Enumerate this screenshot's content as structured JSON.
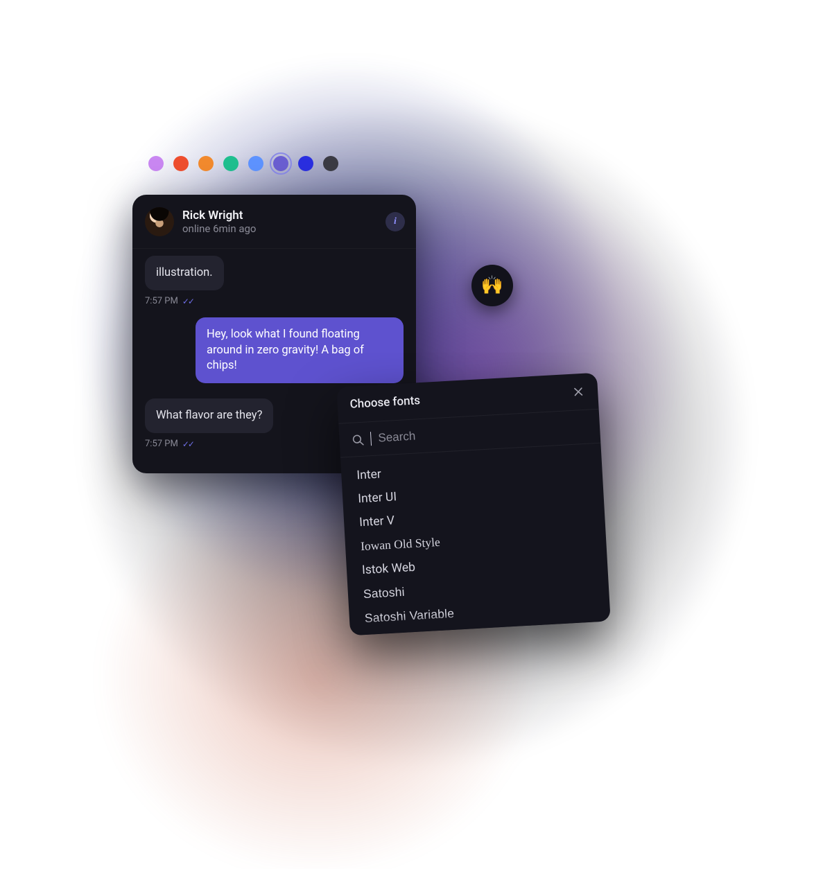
{
  "colors": {
    "swatches": [
      "#c987f2",
      "#ee4e2e",
      "#f28a2e",
      "#1fbf8f",
      "#5e93ff",
      "#6a5ed1",
      "#2a2fe0",
      "#3b3b44"
    ],
    "selected_index": 5
  },
  "chat": {
    "name": "Rick Wright",
    "status": "online 6min ago",
    "messages": [
      {
        "text": "illustration.",
        "mine": false,
        "time": "7:57 PM",
        "read": true
      },
      {
        "text": "Hey, look what I found floating around in zero gravity! A bag of chips!",
        "mine": true,
        "time": "",
        "read": false
      },
      {
        "text": "What flavor are they?",
        "mine": false,
        "time": "7:57 PM",
        "read": true
      }
    ]
  },
  "reaction": {
    "emoji": "🙌"
  },
  "fonts": {
    "title": "Choose fonts",
    "search_placeholder": "Search",
    "items": [
      "Inter",
      "Inter UI",
      "Inter V",
      "Iowan Old Style",
      "Istok Web",
      "Satoshi",
      "Satoshi Variable"
    ]
  }
}
